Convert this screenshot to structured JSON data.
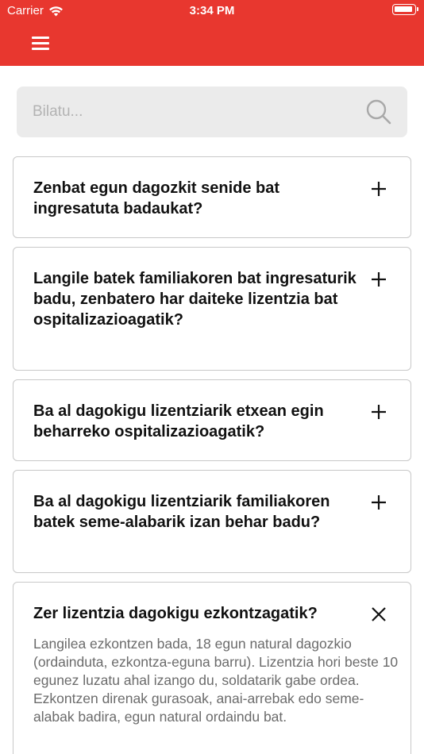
{
  "status_bar": {
    "carrier": "Carrier",
    "time": "3:34 PM"
  },
  "header": {
    "menu_icon": "hamburger-menu-icon",
    "background_color": "#e8372f"
  },
  "search": {
    "placeholder": "Bilatu...",
    "value": "",
    "icon": "search-icon"
  },
  "faq": {
    "items": [
      {
        "question": "Zenbat egun dagozkit senide bat ingresatuta badaukat?",
        "expanded": false
      },
      {
        "question": "Langile batek familiakoren bat ingresaturik badu, zenbatero har daiteke lizentzia bat ospitalizazioagatik?",
        "expanded": false
      },
      {
        "question": "Ba al dagokigu lizentziarik etxean egin beharreko ospitalizazioagatik?",
        "expanded": false
      },
      {
        "question": "Ba al dagokigu lizentziarik familiakoren batek seme-alabarik izan behar badu?",
        "expanded": false
      },
      {
        "question": "Zer lizentzia dagokigu ezkontzagatik?",
        "expanded": true,
        "answer": "Langilea ezkontzen bada, 18 egun natural dagozkio (ordainduta, ezkontza-eguna barru). Lizentzia hori beste 10 egunez luzatu ahal izango du, soldatarik gabe ordea. Ezkontzen direnak gurasoak, anai-arrebak edo seme-alabak badira, egun natural ordaindu bat."
      }
    ]
  }
}
